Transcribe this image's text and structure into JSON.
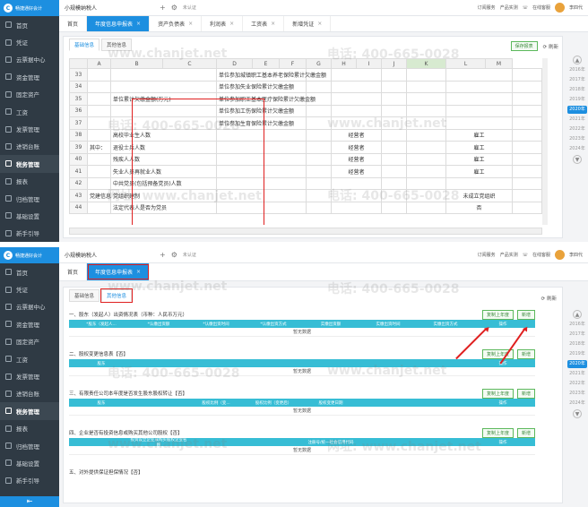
{
  "app": {
    "logo_text": "畅捷通好会计",
    "company": "小规模纳税人",
    "env_label": "未认证",
    "header_actions": [
      "订阅服务",
      "产品实测"
    ],
    "service": "在线客服",
    "user": "李四代"
  },
  "sidebar": {
    "items": [
      {
        "label": "首页"
      },
      {
        "label": "凭证"
      },
      {
        "label": "云票据中心"
      },
      {
        "label": "资金管理"
      },
      {
        "label": "固定资产"
      },
      {
        "label": "工资"
      },
      {
        "label": "发票管理"
      },
      {
        "label": "进销台账"
      },
      {
        "label": "税务管理"
      },
      {
        "label": "报表"
      },
      {
        "label": "归档管理"
      },
      {
        "label": "基础设置"
      },
      {
        "label": "新手引导"
      }
    ],
    "active_index": 8
  },
  "top": {
    "tabs": [
      {
        "label": "首页"
      },
      {
        "label": "年度信息申报表"
      },
      {
        "label": "资产负债表"
      },
      {
        "label": "利润表"
      },
      {
        "label": "工资表"
      },
      {
        "label": "新增凭证"
      }
    ],
    "subtabs": [
      "基础信息",
      "其他信息"
    ],
    "action_btn": "保存报表",
    "refresh": "刷新",
    "columns": [
      "A",
      "B",
      "C",
      "D",
      "E",
      "F",
      "G",
      "H",
      "I",
      "J",
      "K",
      "L",
      "M"
    ],
    "rows": [
      {
        "n": "33",
        "c2": "",
        "c4": "单位参加城镇职工基本养老保险累计欠缴金额",
        "g": "",
        "k": ""
      },
      {
        "n": "34",
        "c2": "",
        "c4": "单位参加失业保险累计欠缴金额",
        "g": "",
        "k": ""
      },
      {
        "n": "35",
        "c2": "单位累计欠缴金额(万元)",
        "c4": "单位参加职工基本医疗保险累计欠缴金额",
        "g": "",
        "k": ""
      },
      {
        "n": "36",
        "c2": "",
        "c4": "单位参加工伤保险累计欠缴金额",
        "g": "",
        "k": ""
      },
      {
        "n": "37",
        "c2": "",
        "c4": "单位参加生育保险累计欠缴金额",
        "g": "",
        "k": ""
      },
      {
        "n": "38",
        "c2": "高校毕业生人数",
        "c4": "",
        "g": "经营者",
        "k": "雇工"
      },
      {
        "n": "39",
        "c2": "退役士兵人数",
        "c4": "",
        "g": "经营者",
        "k": "雇工"
      },
      {
        "n": "40",
        "c2": "残疾人人数",
        "c4": "",
        "g": "经营者",
        "k": "雇工"
      },
      {
        "n": "41",
        "c2": "失业人员再就业人数",
        "c4": "",
        "g": "经营者",
        "k": "雇工"
      },
      {
        "n": "42",
        "c2": "中共党员(包括预备党员)人数",
        "c4": "",
        "g": "",
        "k": ""
      },
      {
        "n": "43",
        "c2": "党组织建制",
        "c4": "",
        "g": "",
        "k": "未成立党组织"
      },
      {
        "n": "44",
        "c2": "法定代表人是否为党员",
        "c4": "",
        "g": "",
        "k": "否"
      }
    ],
    "label_qizhong": "其中：",
    "label_dangjian": "党建信息",
    "years": [
      "2016年",
      "2017年",
      "2018年",
      "2019年",
      "2020年",
      "2021年",
      "2022年",
      "2023年",
      "2024年"
    ],
    "active_year": "2020年"
  },
  "bottom": {
    "active_tab": "年度信息申报表",
    "subtabs": [
      "基础信息",
      "其他信息"
    ],
    "refresh": "刷新",
    "copy_btn": "复制上年度",
    "add_btn": "新增",
    "empty_text": "暂无数据",
    "sections": [
      {
        "title": "一、股东（发起人）出资情况表（币种：人民币万元）",
        "cols": [
          "*股东（发起人...",
          "*认缴出资额",
          "*认缴出资时间",
          "*认缴出资方式",
          "实缴出资额",
          "实缴出资时间",
          "实缴出资方式",
          "操作"
        ],
        "has_copy": true
      },
      {
        "title": "二、股权变更信息表【否】",
        "cols": [
          "股东",
          "",
          "",
          "",
          "",
          "",
          "",
          "操作"
        ],
        "has_copy": true
      },
      {
        "title": "三、有限责任公司本年度是否发生股东股权转让【否】",
        "cols": [
          "股东",
          "",
          "股权比例（变...",
          "股权比例（变更后）",
          "股权变更日期",
          "",
          "",
          "操作"
        ],
        "has_copy": true
      },
      {
        "title": "四、企业是否有投资信息或购买其他公司股权【否】",
        "cols": [
          "",
          "投资设立企业或购买股权企业名称",
          "",
          "",
          "注册号/统一社会信用代码",
          "",
          "",
          "操作"
        ],
        "has_copy": true
      },
      {
        "title": "五、对外提供保证担保情况【否】",
        "cols": [],
        "has_copy": false
      }
    ],
    "years": [
      "2016年",
      "2017年",
      "2018年",
      "2019年",
      "2020年",
      "2021年",
      "2022年",
      "2023年",
      "2024年"
    ],
    "active_year": "2020年"
  },
  "watermark": {
    "site": "www.chanjet.net",
    "phone": "电话: 400-665-0028",
    "site_label": "网址: www.chanjet.net"
  }
}
